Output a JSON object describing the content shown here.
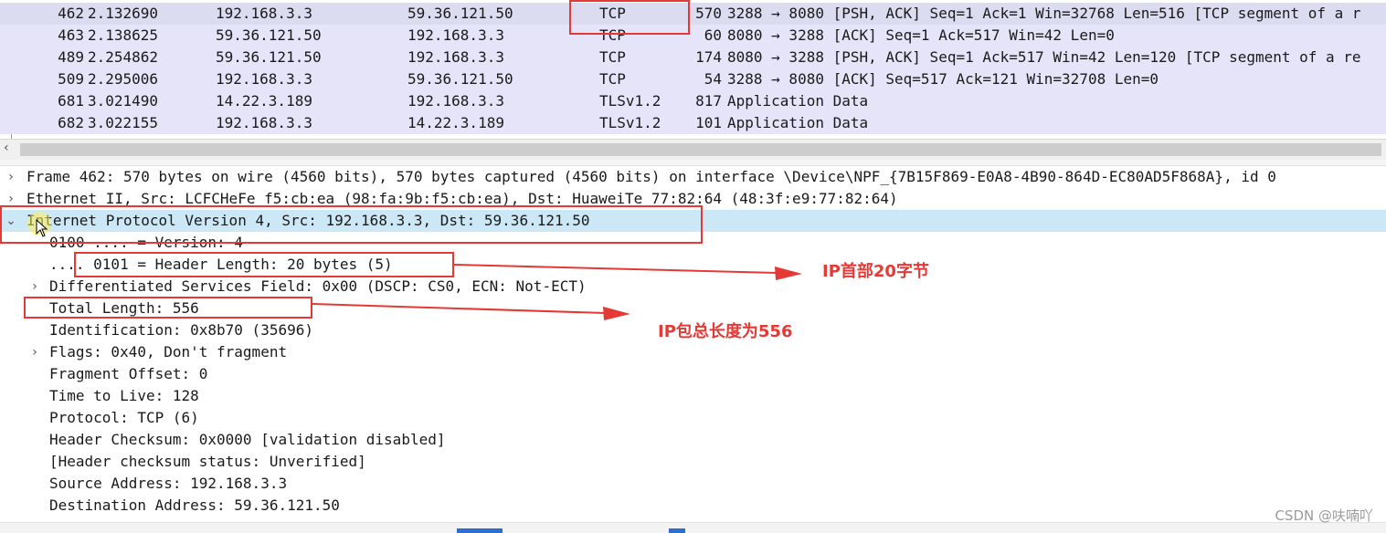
{
  "packet_list": {
    "rows": [
      {
        "no": "462",
        "time": "2.132690",
        "src": "192.168.3.3",
        "dst": "59.36.121.50",
        "proto": "TCP",
        "len": "570",
        "info": "3288 → 8080 [PSH, ACK] Seq=1 Ack=1 Win=32768 Len=516 [TCP segment of a r"
      },
      {
        "no": "463",
        "time": "2.138625",
        "src": "59.36.121.50",
        "dst": "192.168.3.3",
        "proto": "TCP",
        "len": "60",
        "info": "8080 → 3288 [ACK] Seq=1 Ack=517 Win=42 Len=0"
      },
      {
        "no": "489",
        "time": "2.254862",
        "src": "59.36.121.50",
        "dst": "192.168.3.3",
        "proto": "TCP",
        "len": "174",
        "info": "8080 → 3288 [PSH, ACK] Seq=1 Ack=517 Win=42 Len=120 [TCP segment of a re"
      },
      {
        "no": "509",
        "time": "2.295006",
        "src": "192.168.3.3",
        "dst": "59.36.121.50",
        "proto": "TCP",
        "len": "54",
        "info": "3288 → 8080 [ACK] Seq=517 Ack=121 Win=32708 Len=0"
      },
      {
        "no": "681",
        "time": "3.021490",
        "src": "14.22.3.189",
        "dst": "192.168.3.3",
        "proto": "TLSv1.2",
        "len": "817",
        "info": "Application Data"
      },
      {
        "no": "682",
        "time": "3.022155",
        "src": "192.168.3.3",
        "dst": "14.22.3.189",
        "proto": "TLSv1.2",
        "len": "101",
        "info": "Application Data"
      }
    ]
  },
  "details": {
    "rows": [
      {
        "text": "Frame 462: 570 bytes on wire (4560 bits), 570 bytes captured (4560 bits) on interface \\Device\\NPF_{7B15F869-E0A8-4B90-864D-EC80AD5F868A}, id 0"
      },
      {
        "text": "Ethernet II, Src: LCFCHeFe_f5:cb:ea (98:fa:9b:f5:cb:ea), Dst: HuaweiTe_77:82:64 (48:3f:e9:77:82:64)"
      },
      {
        "text": "Internet Protocol Version 4, Src: 192.168.3.3, Dst: 59.36.121.50"
      },
      {
        "text": "0100 .... = Version: 4"
      },
      {
        "text": ".... 0101 = Header Length: 20 bytes (5)"
      },
      {
        "text": "Differentiated Services Field: 0x00 (DSCP: CS0, ECN: Not-ECT)"
      },
      {
        "text": "Total Length: 556"
      },
      {
        "text": "Identification: 0x8b70 (35696)"
      },
      {
        "text": "Flags: 0x40, Don't fragment"
      },
      {
        "text": "Fragment Offset: 0"
      },
      {
        "text": "Time to Live: 128"
      },
      {
        "text": "Protocol: TCP (6)"
      },
      {
        "text": "Header Checksum: 0x0000 [validation disabled]"
      },
      {
        "text": "[Header checksum status: Unverified]"
      },
      {
        "text": "Source Address: 192.168.3.3"
      },
      {
        "text": "Destination Address: 59.36.121.50"
      }
    ]
  },
  "annotations": {
    "header_note": "IP首部20字节",
    "length_note": "IP包总长度为556"
  },
  "watermark": "CSDN @呋喃吖",
  "colors": {
    "accent": "#e53935",
    "selection": "#cce8f7",
    "packet_row": "#e6e4f8"
  }
}
